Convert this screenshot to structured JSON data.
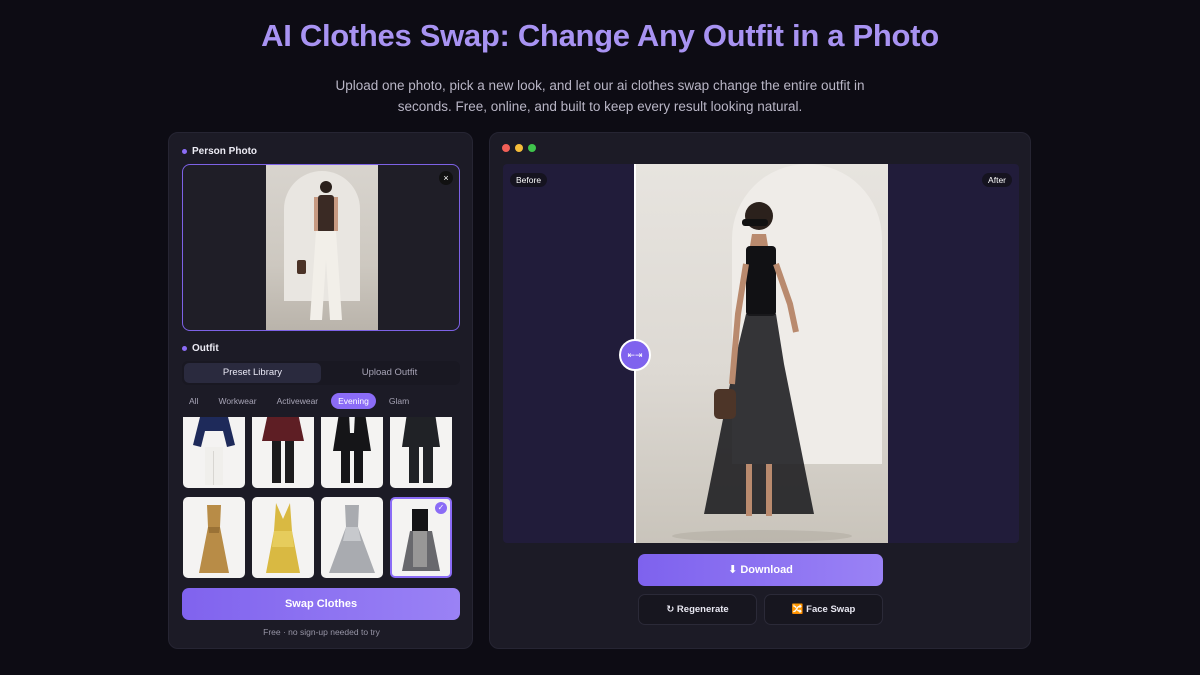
{
  "header": {
    "title": "AI Clothes Swap: Change Any Outfit in a Photo",
    "subtitle": "Upload one photo, pick a new look, and let our ai clothes swap change the entire outfit in seconds. Free, online, and built to keep every result looking natural."
  },
  "left_panel": {
    "person_label": "Person Photo",
    "close_symbol": "×",
    "outfit_label": "Outfit",
    "tabs": [
      {
        "label": "Preset Library",
        "active": true
      },
      {
        "label": "Upload Outfit",
        "active": false
      }
    ],
    "filters": [
      {
        "label": "All",
        "active": false
      },
      {
        "label": "Workwear",
        "active": false
      },
      {
        "label": "Activewear",
        "active": false
      },
      {
        "label": "Evening",
        "active": true
      },
      {
        "label": "Glam",
        "active": false
      }
    ],
    "selected_check": "✓",
    "swap_button": "Swap Clothes",
    "free_note": "Free · no sign-up needed to try"
  },
  "right_panel": {
    "before_tag": "Before",
    "after_tag": "After",
    "handle_symbol": "⇤⇥",
    "download_button": "⬇ Download",
    "regenerate_button": "↻ Regenerate",
    "face_swap_button": "🔀 Face Swap"
  },
  "colors": {
    "accent": "#8b6cf6",
    "title": "#a893f2",
    "background": "#0d0c14",
    "panel": "#1c1b26"
  }
}
